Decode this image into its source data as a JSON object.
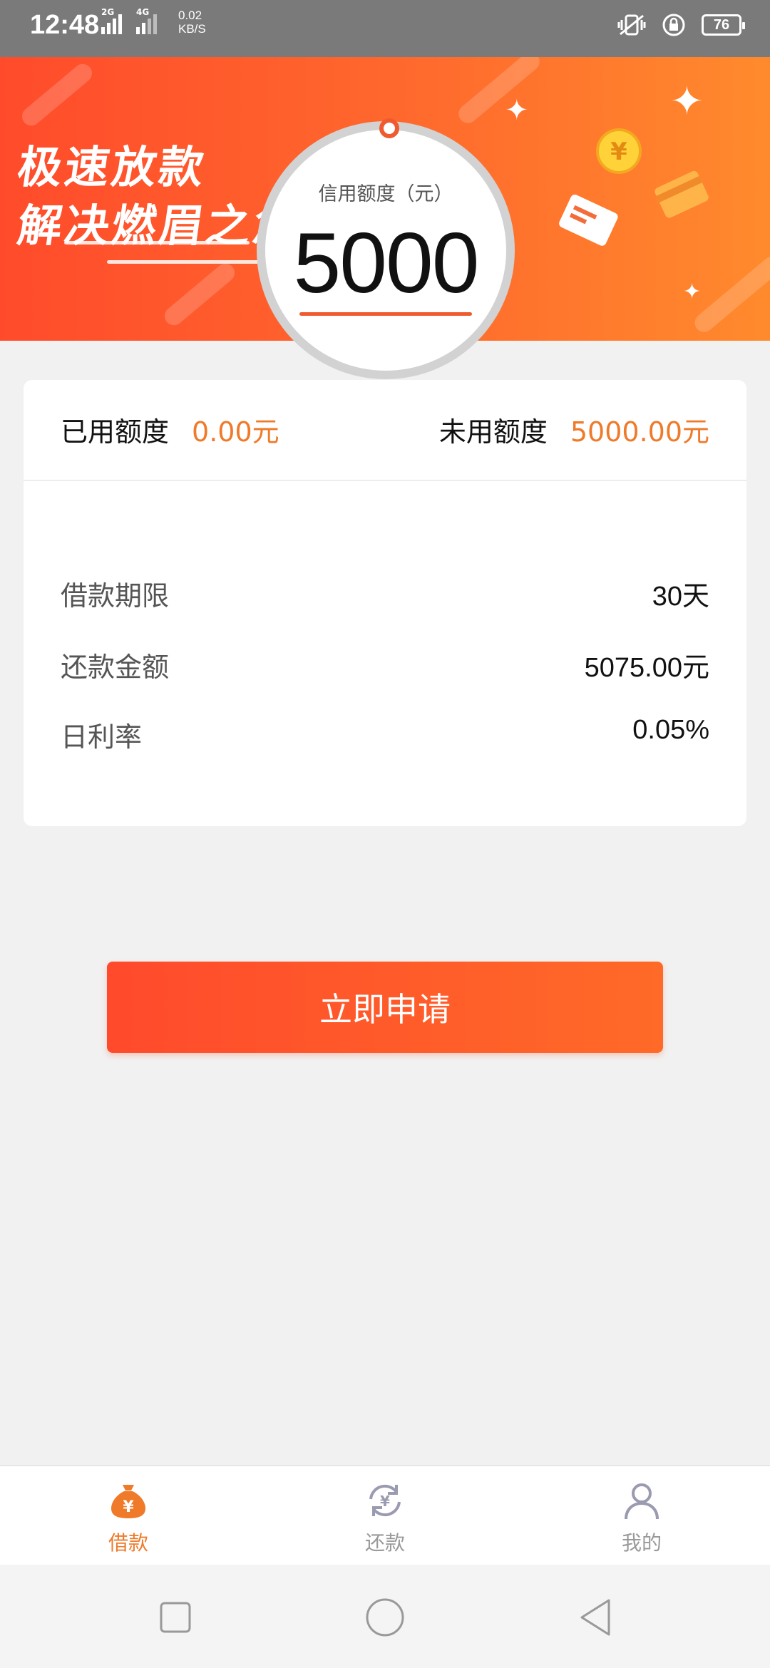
{
  "status_bar": {
    "time": "12:48",
    "sim1_label": "2G",
    "sim2_label": "4G",
    "speed_value": "0.02",
    "speed_unit": "KB/S",
    "battery": "76"
  },
  "banner": {
    "slogan_line1": "极速放款",
    "slogan_line2": "解决燃眉之急",
    "credit_label": "信用额度（元）",
    "credit_value": "5000"
  },
  "quota": {
    "used_label": "已用额度",
    "used_value": "0.00元",
    "unused_label": "未用额度",
    "unused_value": "5000.00元"
  },
  "details": [
    {
      "label": "借款期限",
      "value": "30天"
    },
    {
      "label": "还款金额",
      "value": "5075.00元"
    },
    {
      "label": "日利率",
      "value": "0.05%"
    }
  ],
  "apply_button": "立即申请",
  "bottom_nav": {
    "items": [
      {
        "label": "借款",
        "icon": "money-bag-icon",
        "active": true
      },
      {
        "label": "还款",
        "icon": "repay-cycle-icon",
        "active": false
      },
      {
        "label": "我的",
        "icon": "person-icon",
        "active": false
      }
    ]
  },
  "colors": {
    "accent": "#ef7a2a",
    "banner_start": "#ff4b2b",
    "banner_end": "#ff8a2d",
    "button": "#ff5a2a"
  },
  "system_nav": {
    "icons": [
      "recents-square-icon",
      "home-circle-icon",
      "back-triangle-icon"
    ]
  }
}
